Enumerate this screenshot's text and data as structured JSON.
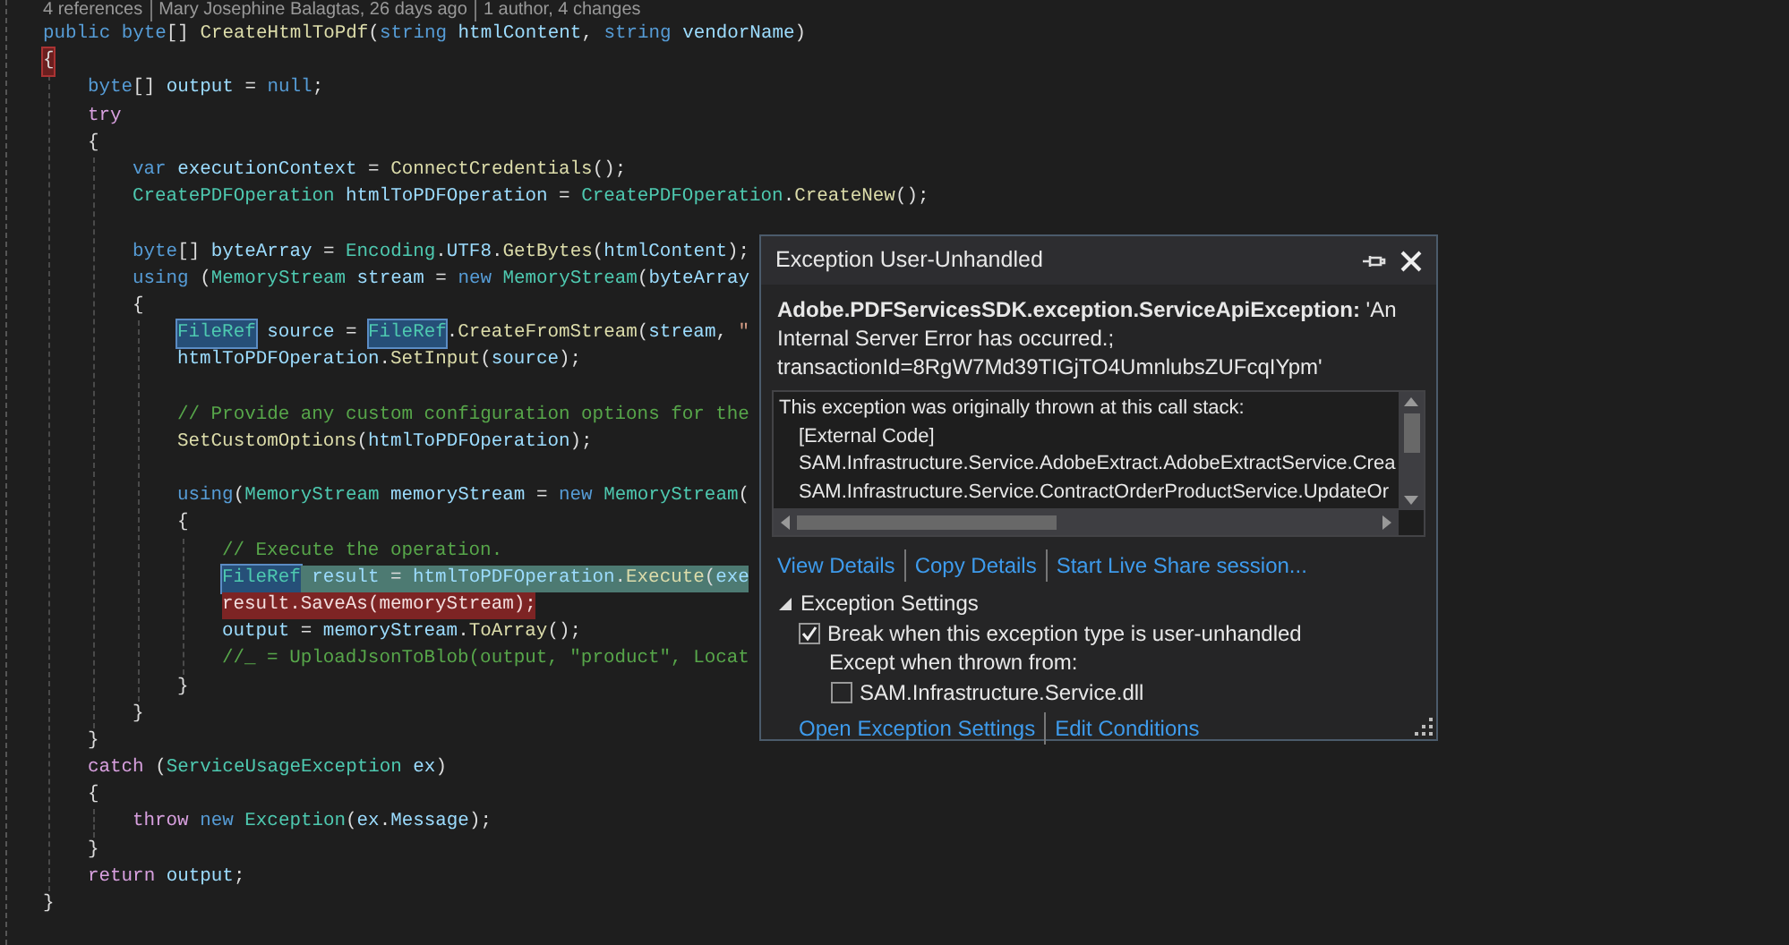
{
  "code_lens": [
    "4 references",
    "Mary Josephine Balagtas, 26 days ago",
    "1 author, 4 changes"
  ],
  "code": [
    {
      "kind": "code",
      "tokens": [
        {
          "kind": "keyword",
          "text": "public "
        },
        {
          "kind": "keyword",
          "text": "byte"
        },
        {
          "kind": "plain",
          "text": "[] "
        },
        {
          "kind": "method",
          "text": "CreateHtmlToPdf"
        },
        {
          "kind": "plain",
          "text": "("
        },
        {
          "kind": "keyword",
          "text": "string "
        },
        {
          "kind": "variable",
          "text": "htmlContent"
        },
        {
          "kind": "plain",
          "text": ", "
        },
        {
          "kind": "keyword",
          "text": "string "
        },
        {
          "kind": "variable",
          "text": "vendorName"
        },
        {
          "kind": "plain",
          "text": ")"
        }
      ]
    },
    {
      "kind": "code",
      "tokens": [
        {
          "kind": "plain",
          "text": "{",
          "brace_match": true
        }
      ],
      "children": [
        {
          "kind": "code",
          "tokens": [
            {
              "kind": "keyword",
              "text": "byte"
            },
            {
              "kind": "plain",
              "text": "[] "
            },
            {
              "kind": "variable",
              "text": "output"
            },
            {
              "kind": "plain",
              "text": " = "
            },
            {
              "kind": "keyword",
              "text": "null"
            },
            {
              "kind": "plain",
              "text": ";"
            }
          ]
        },
        {
          "kind": "code",
          "tokens": [
            {
              "kind": "control",
              "text": "try"
            }
          ]
        },
        {
          "kind": "code",
          "tokens": [
            {
              "kind": "plain",
              "text": "{"
            }
          ],
          "children": [
            {
              "kind": "code",
              "tokens": [
                {
                  "kind": "keyword",
                  "text": "var "
                },
                {
                  "kind": "variable",
                  "text": "executionContext"
                },
                {
                  "kind": "plain",
                  "text": " = "
                },
                {
                  "kind": "method",
                  "text": "ConnectCredentials"
                },
                {
                  "kind": "plain",
                  "text": "();"
                }
              ]
            },
            {
              "kind": "code",
              "tokens": [
                {
                  "kind": "type",
                  "text": "CreatePDFOperation "
                },
                {
                  "kind": "variable",
                  "text": "htmlToPDFOperation"
                },
                {
                  "kind": "plain",
                  "text": " = "
                },
                {
                  "kind": "type",
                  "text": "CreatePDFOperation"
                },
                {
                  "kind": "plain",
                  "text": "."
                },
                {
                  "kind": "method",
                  "text": "CreateNew"
                },
                {
                  "kind": "plain",
                  "text": "();"
                }
              ]
            },
            {
              "kind": "blank"
            },
            {
              "kind": "code",
              "tokens": [
                {
                  "kind": "keyword",
                  "text": "byte"
                },
                {
                  "kind": "plain",
                  "text": "[] "
                },
                {
                  "kind": "variable",
                  "text": "byteArray"
                },
                {
                  "kind": "plain",
                  "text": " = "
                },
                {
                  "kind": "type",
                  "text": "Encoding"
                },
                {
                  "kind": "plain",
                  "text": "."
                },
                {
                  "kind": "variable",
                  "text": "UTF8"
                },
                {
                  "kind": "plain",
                  "text": "."
                },
                {
                  "kind": "method",
                  "text": "GetBytes"
                },
                {
                  "kind": "plain",
                  "text": "("
                },
                {
                  "kind": "variable",
                  "text": "htmlContent"
                },
                {
                  "kind": "plain",
                  "text": ");"
                }
              ]
            },
            {
              "kind": "code",
              "tokens": [
                {
                  "kind": "keyword",
                  "text": "using"
                },
                {
                  "kind": "plain",
                  "text": " ("
                },
                {
                  "kind": "type",
                  "text": "MemoryStream "
                },
                {
                  "kind": "variable",
                  "text": "stream"
                },
                {
                  "kind": "plain",
                  "text": " = "
                },
                {
                  "kind": "keyword",
                  "text": "new "
                },
                {
                  "kind": "type",
                  "text": "MemoryStream"
                },
                {
                  "kind": "plain",
                  "text": "("
                },
                {
                  "kind": "variable",
                  "text": "byteArray"
                }
              ]
            },
            {
              "kind": "code",
              "tokens": [
                {
                  "kind": "plain",
                  "text": "{"
                }
              ],
              "children": [
                {
                  "kind": "code",
                  "tokens": [
                    {
                      "kind": "type",
                      "text": "FileRef",
                      "reference_highlight": true
                    },
                    {
                      "kind": "variable",
                      "text": " source"
                    },
                    {
                      "kind": "plain",
                      "text": " = "
                    },
                    {
                      "kind": "type",
                      "text": "FileRef",
                      "reference_highlight": true
                    },
                    {
                      "kind": "plain",
                      "text": "."
                    },
                    {
                      "kind": "method",
                      "text": "CreateFromStream"
                    },
                    {
                      "kind": "plain",
                      "text": "("
                    },
                    {
                      "kind": "variable",
                      "text": "stream"
                    },
                    {
                      "kind": "plain",
                      "text": ", "
                    },
                    {
                      "kind": "string",
                      "text": "\""
                    }
                  ]
                },
                {
                  "kind": "code",
                  "tokens": [
                    {
                      "kind": "variable",
                      "text": "htmlToPDFOperation"
                    },
                    {
                      "kind": "plain",
                      "text": "."
                    },
                    {
                      "kind": "method",
                      "text": "SetInput"
                    },
                    {
                      "kind": "plain",
                      "text": "("
                    },
                    {
                      "kind": "variable",
                      "text": "source"
                    },
                    {
                      "kind": "plain",
                      "text": ");"
                    }
                  ]
                },
                {
                  "kind": "blank"
                },
                {
                  "kind": "code",
                  "tokens": [
                    {
                      "kind": "comment",
                      "text": "// Provide any custom configuration options for the"
                    }
                  ]
                },
                {
                  "kind": "code",
                  "tokens": [
                    {
                      "kind": "method",
                      "text": "SetCustomOptions"
                    },
                    {
                      "kind": "plain",
                      "text": "("
                    },
                    {
                      "kind": "variable",
                      "text": "htmlToPDFOperation"
                    },
                    {
                      "kind": "plain",
                      "text": ");"
                    }
                  ]
                },
                {
                  "kind": "blank"
                },
                {
                  "kind": "code",
                  "tokens": [
                    {
                      "kind": "keyword",
                      "text": "using"
                    },
                    {
                      "kind": "plain",
                      "text": "("
                    },
                    {
                      "kind": "type",
                      "text": "MemoryStream "
                    },
                    {
                      "kind": "variable",
                      "text": "memoryStream"
                    },
                    {
                      "kind": "plain",
                      "text": " = "
                    },
                    {
                      "kind": "keyword",
                      "text": "new "
                    },
                    {
                      "kind": "type",
                      "text": "MemoryStream"
                    },
                    {
                      "kind": "plain",
                      "text": "("
                    }
                  ]
                },
                {
                  "kind": "code",
                  "tokens": [
                    {
                      "kind": "plain",
                      "text": "{"
                    }
                  ],
                  "children": [
                    {
                      "kind": "code",
                      "tokens": [
                        {
                          "kind": "comment",
                          "text": "// Execute the operation."
                        }
                      ]
                    },
                    {
                      "kind": "code",
                      "tokens": [
                        {
                          "kind": "type",
                          "text": "FileRef",
                          "reference_highlight": true
                        },
                        {
                          "kind": "variable",
                          "text": " result",
                          "current_statement": true
                        },
                        {
                          "kind": "plain",
                          "text": " = ",
                          "current_statement": true
                        },
                        {
                          "kind": "variable",
                          "text": "htmlToPDFOperation",
                          "current_statement": true
                        },
                        {
                          "kind": "plain",
                          "text": ".",
                          "current_statement": true
                        },
                        {
                          "kind": "method",
                          "text": "Execute",
                          "current_statement": true
                        },
                        {
                          "kind": "plain",
                          "text": "(",
                          "current_statement": true
                        },
                        {
                          "kind": "variable",
                          "text": "exe",
                          "current_statement": true
                        }
                      ]
                    },
                    {
                      "kind": "code",
                      "tokens": [
                        {
                          "kind": "variable",
                          "text": "result",
                          "error": true
                        },
                        {
                          "kind": "plain",
                          "text": ".",
                          "error": true
                        },
                        {
                          "kind": "method",
                          "text": "SaveAs",
                          "error": true
                        },
                        {
                          "kind": "plain",
                          "text": "(",
                          "error": true
                        },
                        {
                          "kind": "variable",
                          "text": "memoryStream",
                          "error": true
                        },
                        {
                          "kind": "plain",
                          "text": ");",
                          "error": true
                        }
                      ]
                    },
                    {
                      "kind": "code",
                      "tokens": [
                        {
                          "kind": "variable",
                          "text": "output"
                        },
                        {
                          "kind": "plain",
                          "text": " = "
                        },
                        {
                          "kind": "variable",
                          "text": "memoryStream"
                        },
                        {
                          "kind": "plain",
                          "text": "."
                        },
                        {
                          "kind": "method",
                          "text": "ToArray"
                        },
                        {
                          "kind": "plain",
                          "text": "();"
                        }
                      ]
                    },
                    {
                      "kind": "code",
                      "tokens": [
                        {
                          "kind": "comment",
                          "text": "//_ = UploadJsonToBlob(output, \"product\", Locat"
                        }
                      ]
                    }
                  ]
                },
                {
                  "kind": "code",
                  "tokens": [
                    {
                      "kind": "plain",
                      "text": "}"
                    }
                  ]
                }
              ]
            },
            {
              "kind": "code",
              "tokens": [
                {
                  "kind": "plain",
                  "text": "}"
                }
              ]
            }
          ]
        },
        {
          "kind": "code",
          "tokens": [
            {
              "kind": "plain",
              "text": "}"
            }
          ]
        },
        {
          "kind": "code",
          "tokens": [
            {
              "kind": "control",
              "text": "catch"
            },
            {
              "kind": "plain",
              "text": " ("
            },
            {
              "kind": "type",
              "text": "ServiceUsageException "
            },
            {
              "kind": "variable",
              "text": "ex"
            },
            {
              "kind": "plain",
              "text": ")"
            }
          ]
        },
        {
          "kind": "code",
          "tokens": [
            {
              "kind": "plain",
              "text": "{"
            }
          ],
          "children": [
            {
              "kind": "code",
              "tokens": [
                {
                  "kind": "control",
                  "text": "throw "
                },
                {
                  "kind": "keyword",
                  "text": "new "
                },
                {
                  "kind": "type",
                  "text": "Exception"
                },
                {
                  "kind": "plain",
                  "text": "("
                },
                {
                  "kind": "variable",
                  "text": "ex"
                },
                {
                  "kind": "plain",
                  "text": "."
                },
                {
                  "kind": "variable",
                  "text": "Message"
                },
                {
                  "kind": "plain",
                  "text": ");"
                }
              ]
            }
          ]
        },
        {
          "kind": "code",
          "tokens": [
            {
              "kind": "plain",
              "text": "}"
            }
          ]
        },
        {
          "kind": "code",
          "tokens": [
            {
              "kind": "control",
              "text": "return "
            },
            {
              "kind": "variable",
              "text": "output"
            },
            {
              "kind": "plain",
              "text": ";"
            }
          ]
        }
      ]
    },
    {
      "kind": "code",
      "tokens": [
        {
          "kind": "plain",
          "text": "}"
        }
      ]
    }
  ],
  "exception_popup": {
    "title": "Exception User-Unhandled",
    "message": "**Adobe.PDFServicesSDK.exception.ServiceApiException:** 'An Internal Server Error has occurred.; transactionId=8RgW7Md39TIGjTO4UmnlubsZUFcqIYpm'",
    "call_stack": {
      "heading": "This exception was originally thrown at this call stack:",
      "frames": [
        "[External Code]",
        "SAM.Infrastructure.Service.AdobeExtract.AdobeExtractService.Crea",
        "SAM.Infrastructure.Service.ContractOrderProductService.UpdateOr"
      ]
    },
    "links": [
      "View Details",
      "Copy Details",
      "Start Live Share session..."
    ],
    "settings": {
      "heading": "Exception Settings",
      "expanded": true,
      "options": [
        {
          "label": "Break when this exception type is user-unhandled",
          "checked": true
        }
      ],
      "except_label": "Except when thrown from:",
      "modules": [
        {
          "label": "SAM.Infrastructure.Service.dll",
          "checked": false
        }
      ]
    },
    "footer_links": [
      "Open Exception Settings",
      "Edit Conditions"
    ]
  }
}
